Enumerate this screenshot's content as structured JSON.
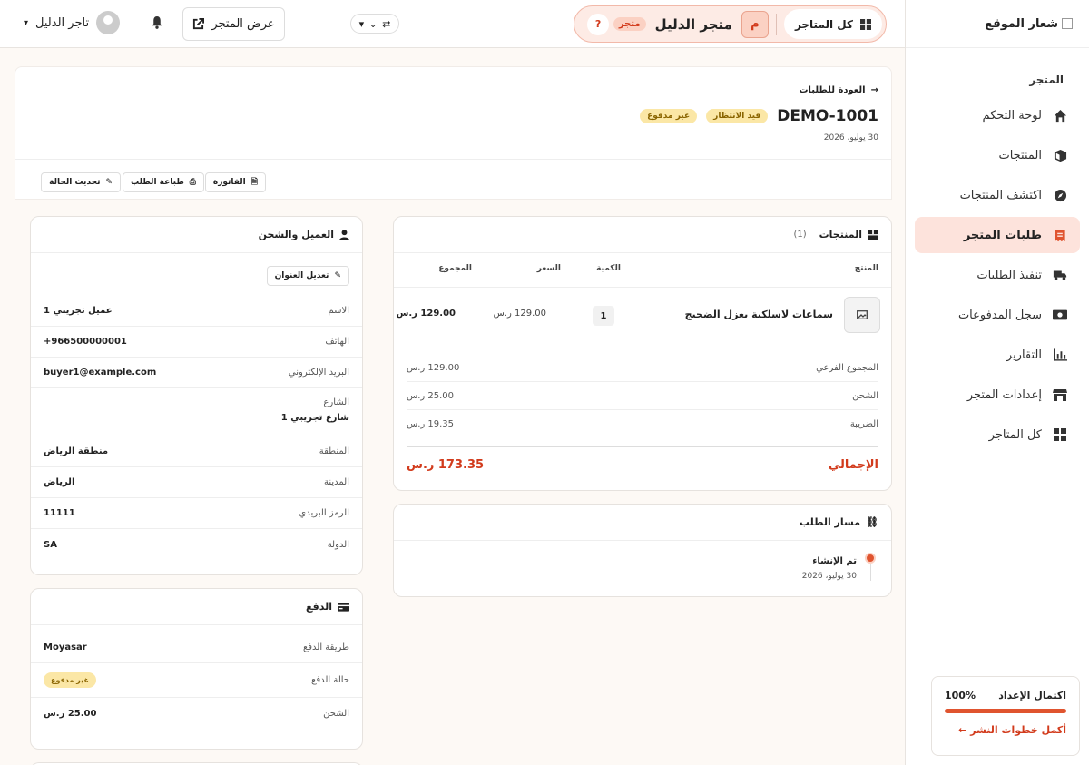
{
  "sidebar": {
    "logo_text": "شعار الموقع",
    "section": "المتجر",
    "items": [
      {
        "label": "لوحة التحكم",
        "icon": "home-icon"
      },
      {
        "label": "المنتجات",
        "icon": "box-icon"
      },
      {
        "label": "اكتشف المنتجات",
        "icon": "compass-icon"
      },
      {
        "label": "طلبات المتجر",
        "icon": "receipt-icon",
        "active": true
      },
      {
        "label": "تنفيذ الطلبات",
        "icon": "truck-icon"
      },
      {
        "label": "سجل المدفوعات",
        "icon": "money-icon"
      },
      {
        "label": "التقارير",
        "icon": "chart-icon"
      },
      {
        "label": "إعدادات المتجر",
        "icon": "store-icon"
      },
      {
        "label": "كل المتاجر",
        "icon": "grid-icon"
      }
    ],
    "setup": {
      "title": "اكتمال الإعداد",
      "percent": "100%",
      "progress": 1.0,
      "link": "أكمل خطوات النشر ←"
    }
  },
  "topbar": {
    "all_stores": "كل المتاجر",
    "store_initial": "م",
    "store_name": "متجر الدليل",
    "store_badge": "متجر",
    "help": "?",
    "view_store": "عرض المتجر",
    "user_name": "تاجر الدليل"
  },
  "order": {
    "back": "العودة للطلبات",
    "id": "DEMO-1001",
    "status": "قيد الانتظار",
    "payment_status": "غير مدفوع",
    "date": "30 يوليو، 2026",
    "actions": {
      "invoice": "الفاتورة",
      "print": "طباعة الطلب",
      "update": "تحديث الحالة"
    }
  },
  "products": {
    "title": "المنتجات",
    "count": "(1)",
    "headers": {
      "product": "المنتج",
      "qty": "الكمية",
      "price": "السعر",
      "total": "المجموع"
    },
    "rows": [
      {
        "name": "سماعات لاسلكية بعزل الضجيج",
        "qty": "1",
        "price": "129.00 ر.س",
        "total": "129.00 ر.س"
      }
    ],
    "summary": [
      {
        "label": "المجموع الفرعي",
        "value": "129.00 ر.س"
      },
      {
        "label": "الشحن",
        "value": "25.00 ر.س"
      },
      {
        "label": "الضريبة",
        "value": "19.35 ر.س"
      }
    ],
    "total_label": "الإجمالي",
    "total_value": "173.35 ر.س"
  },
  "timeline": {
    "title": "مسار الطلب",
    "events": [
      {
        "label": "تم الإنشاء",
        "date": "30 يوليو، 2026"
      }
    ]
  },
  "customer": {
    "title": "العميل والشحن",
    "edit": "تعديل العنوان",
    "fields": [
      {
        "label": "الاسم",
        "value": "عميل تجريبي 1"
      },
      {
        "label": "الهاتف",
        "value": "+966500000001"
      },
      {
        "label": "البريد الإلكتروني",
        "value": "buyer1@example.com"
      }
    ],
    "street_label": "الشارع",
    "street_value": "شارع تجريبي 1",
    "fields2": [
      {
        "label": "المنطقة",
        "value": "منطقة الرياض"
      },
      {
        "label": "المدينة",
        "value": "الرياض"
      },
      {
        "label": "الرمز البريدي",
        "value": "11111"
      },
      {
        "label": "الدولة",
        "value": "SA"
      }
    ]
  },
  "payment": {
    "title": "الدفع",
    "method_label": "طريقة الدفع",
    "method_value": "Moyasar",
    "status_label": "حالة الدفع",
    "status_value": "غير مدفوع",
    "shipping_label": "الشحن",
    "shipping_value": "25.00 ر.س"
  },
  "colors": {
    "accent": "#e0542f",
    "accent_dark": "#d23b1c",
    "badge_bg": "#fbe7a6"
  }
}
